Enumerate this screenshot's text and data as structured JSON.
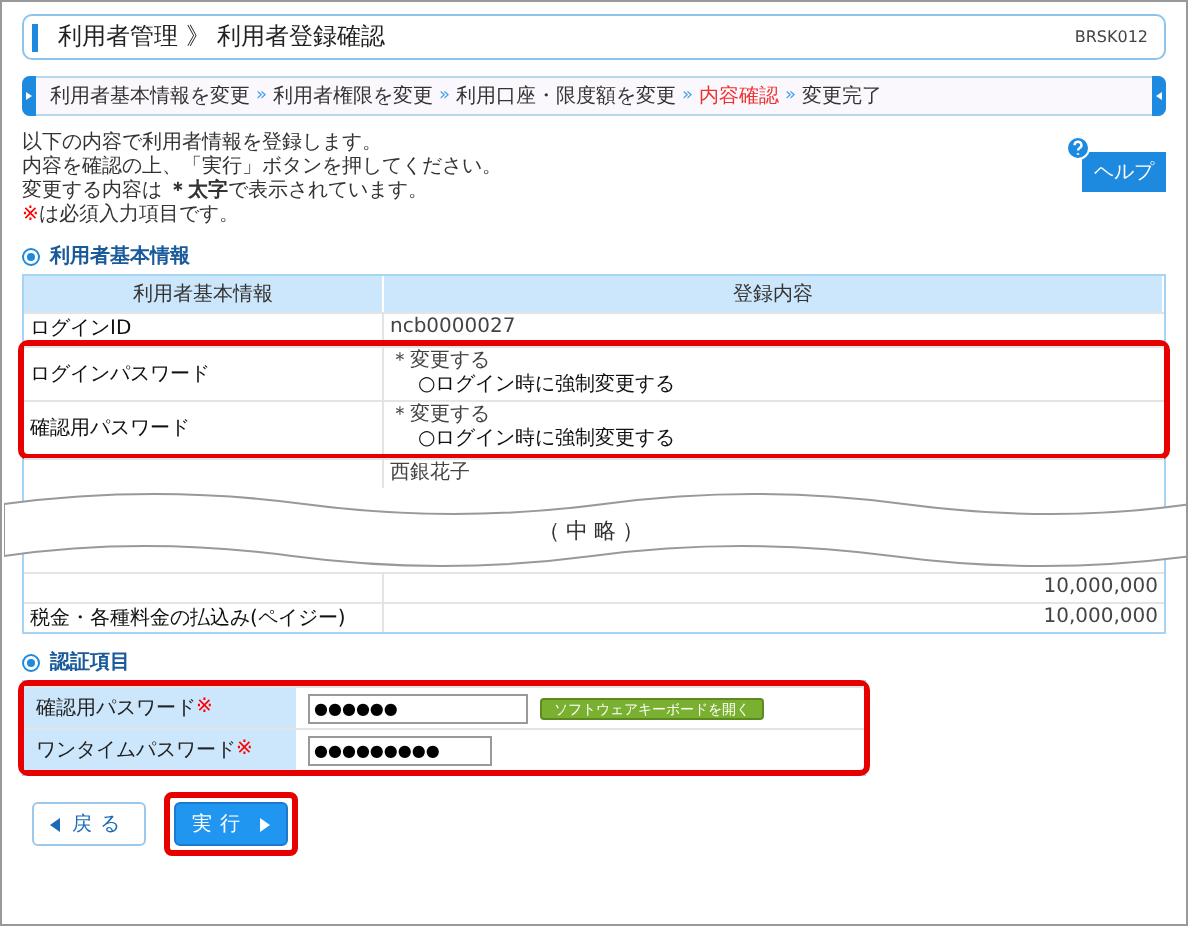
{
  "header": {
    "title": "利用者管理 》 利用者登録確認",
    "screen_id": "BRSK012"
  },
  "step_separator": "»",
  "steps": [
    {
      "label": "利用者基本情報を変更",
      "selected": false
    },
    {
      "label": "利用者権限を変更",
      "selected": false
    },
    {
      "label": "利用口座・限度額を変更",
      "selected": false
    },
    {
      "label": "内容確認",
      "selected": true
    },
    {
      "label": "変更完了",
      "selected": false
    }
  ],
  "instructions": [
    {
      "text": "以下の内容で利用者情報を登録します。"
    },
    {
      "text": "内容を確認の上、「実行」ボタンを押してください。"
    },
    {
      "text": "変更する内容は **＊太字**で表示されています。"
    },
    {
      "mark": "※",
      "text": "は必須入力項目です。"
    }
  ],
  "help_button": "ヘルプ",
  "basic_section": {
    "title": "利用者基本情報",
    "columns": [
      "利用者基本情報",
      "登録内容"
    ],
    "rows": [
      {
        "label": "ログインID",
        "value": "ncb0000027",
        "highlighted": false
      },
      {
        "label": "ログインパスワード",
        "value": "＊変更する",
        "sub": "○ログイン時に強制変更する",
        "highlighted": true
      },
      {
        "label": "確認用パスワード",
        "value": "＊変更する",
        "sub": "○ログイン時に強制変更する",
        "highlighted": true
      },
      {
        "value": "西銀花子",
        "highlighted": false
      }
    ],
    "omission": "（中略）",
    "rows_after": [
      {
        "value": "10,000,000"
      },
      {
        "label": "税金・各種料金の払込み(ペイジー)",
        "value": "10,000,000"
      }
    ]
  },
  "auth_section": {
    "title": "認証項目",
    "highlighted": true,
    "fields": [
      {
        "label": "確認用パスワード",
        "required": "※",
        "value": "●●●●●●",
        "keyboard_button": "ソフトウェアキーボードを開く"
      },
      {
        "label": "ワンタイムパスワード",
        "required": "※",
        "value": "●●●●●●●●●"
      }
    ]
  },
  "buttons": [
    {
      "label": "戻る",
      "kind": "back",
      "highlighted": false
    },
    {
      "label": "実行",
      "kind": "execute",
      "highlighted": true
    }
  ]
}
